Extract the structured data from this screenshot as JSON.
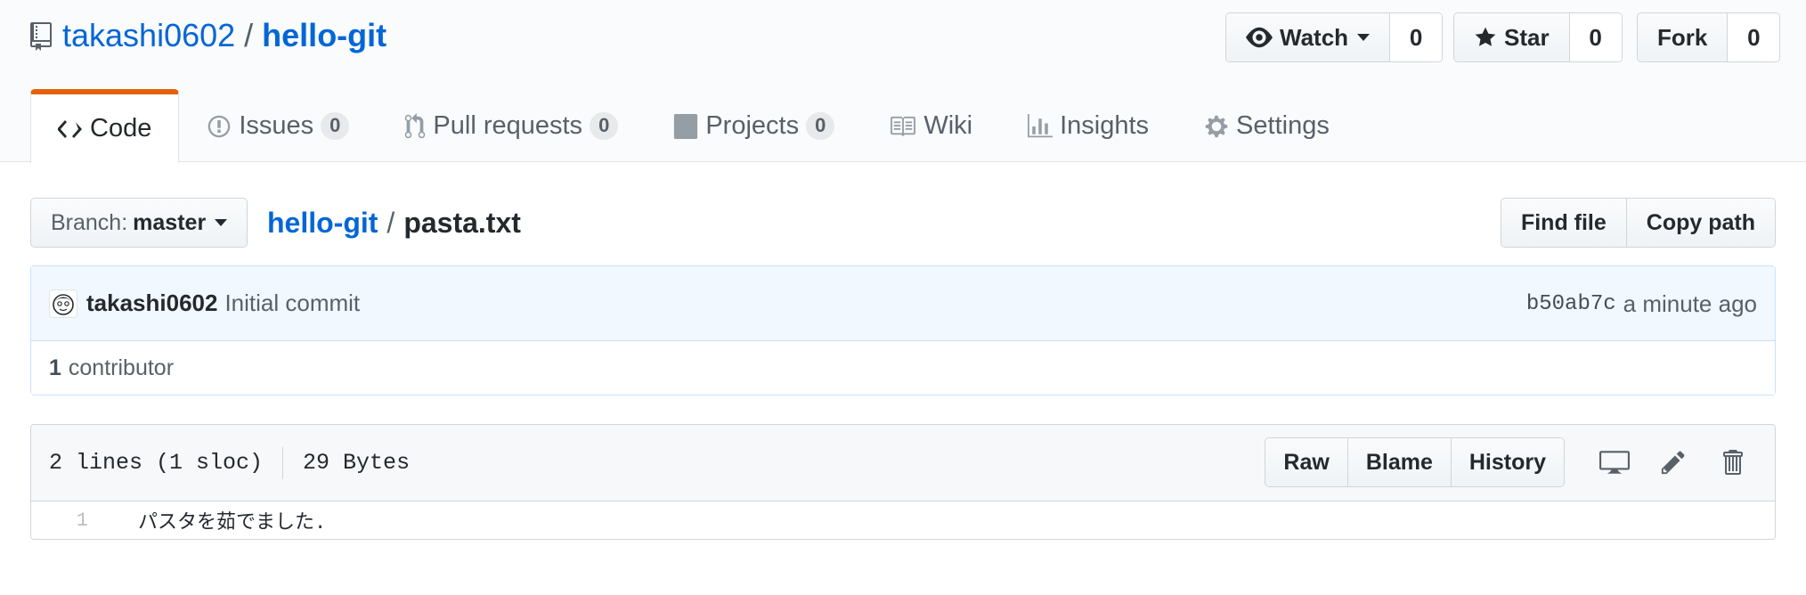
{
  "repo": {
    "owner": "takashi0602",
    "separator": "/",
    "name": "hello-git"
  },
  "actions": {
    "watch_label": "Watch",
    "watch_count": "0",
    "star_label": "Star",
    "star_count": "0",
    "fork_label": "Fork",
    "fork_count": "0"
  },
  "tabs": [
    {
      "label": "Code",
      "icon": "code-icon",
      "selected": true
    },
    {
      "label": "Issues",
      "icon": "issue-icon",
      "count": "0"
    },
    {
      "label": "Pull requests",
      "icon": "pull-request-icon",
      "count": "0"
    },
    {
      "label": "Projects",
      "icon": "project-icon",
      "count": "0"
    },
    {
      "label": "Wiki",
      "icon": "book-icon"
    },
    {
      "label": "Insights",
      "icon": "graph-icon"
    },
    {
      "label": "Settings",
      "icon": "gear-icon"
    }
  ],
  "file_nav": {
    "branch_prefix": "Branch:",
    "branch_name": "master",
    "crumb_repo": "hello-git",
    "crumb_sep": "/",
    "crumb_file": "pasta.txt",
    "find_file_label": "Find file",
    "copy_path_label": "Copy path"
  },
  "commit": {
    "author": "takashi0602",
    "message": "Initial commit",
    "sha": "b50ab7c",
    "time": "a minute ago",
    "contributor_count": "1",
    "contributor_label": "contributor"
  },
  "file": {
    "lines_info": "2 lines (1 sloc)",
    "size": "29 Bytes",
    "raw_label": "Raw",
    "blame_label": "Blame",
    "history_label": "History",
    "lines": [
      {
        "num": "1",
        "code": "パスタを茹でました."
      }
    ]
  },
  "colors": {
    "link": "#0366d6",
    "tab_accent": "#e36209",
    "commit_bg": "#f1f8ff"
  }
}
